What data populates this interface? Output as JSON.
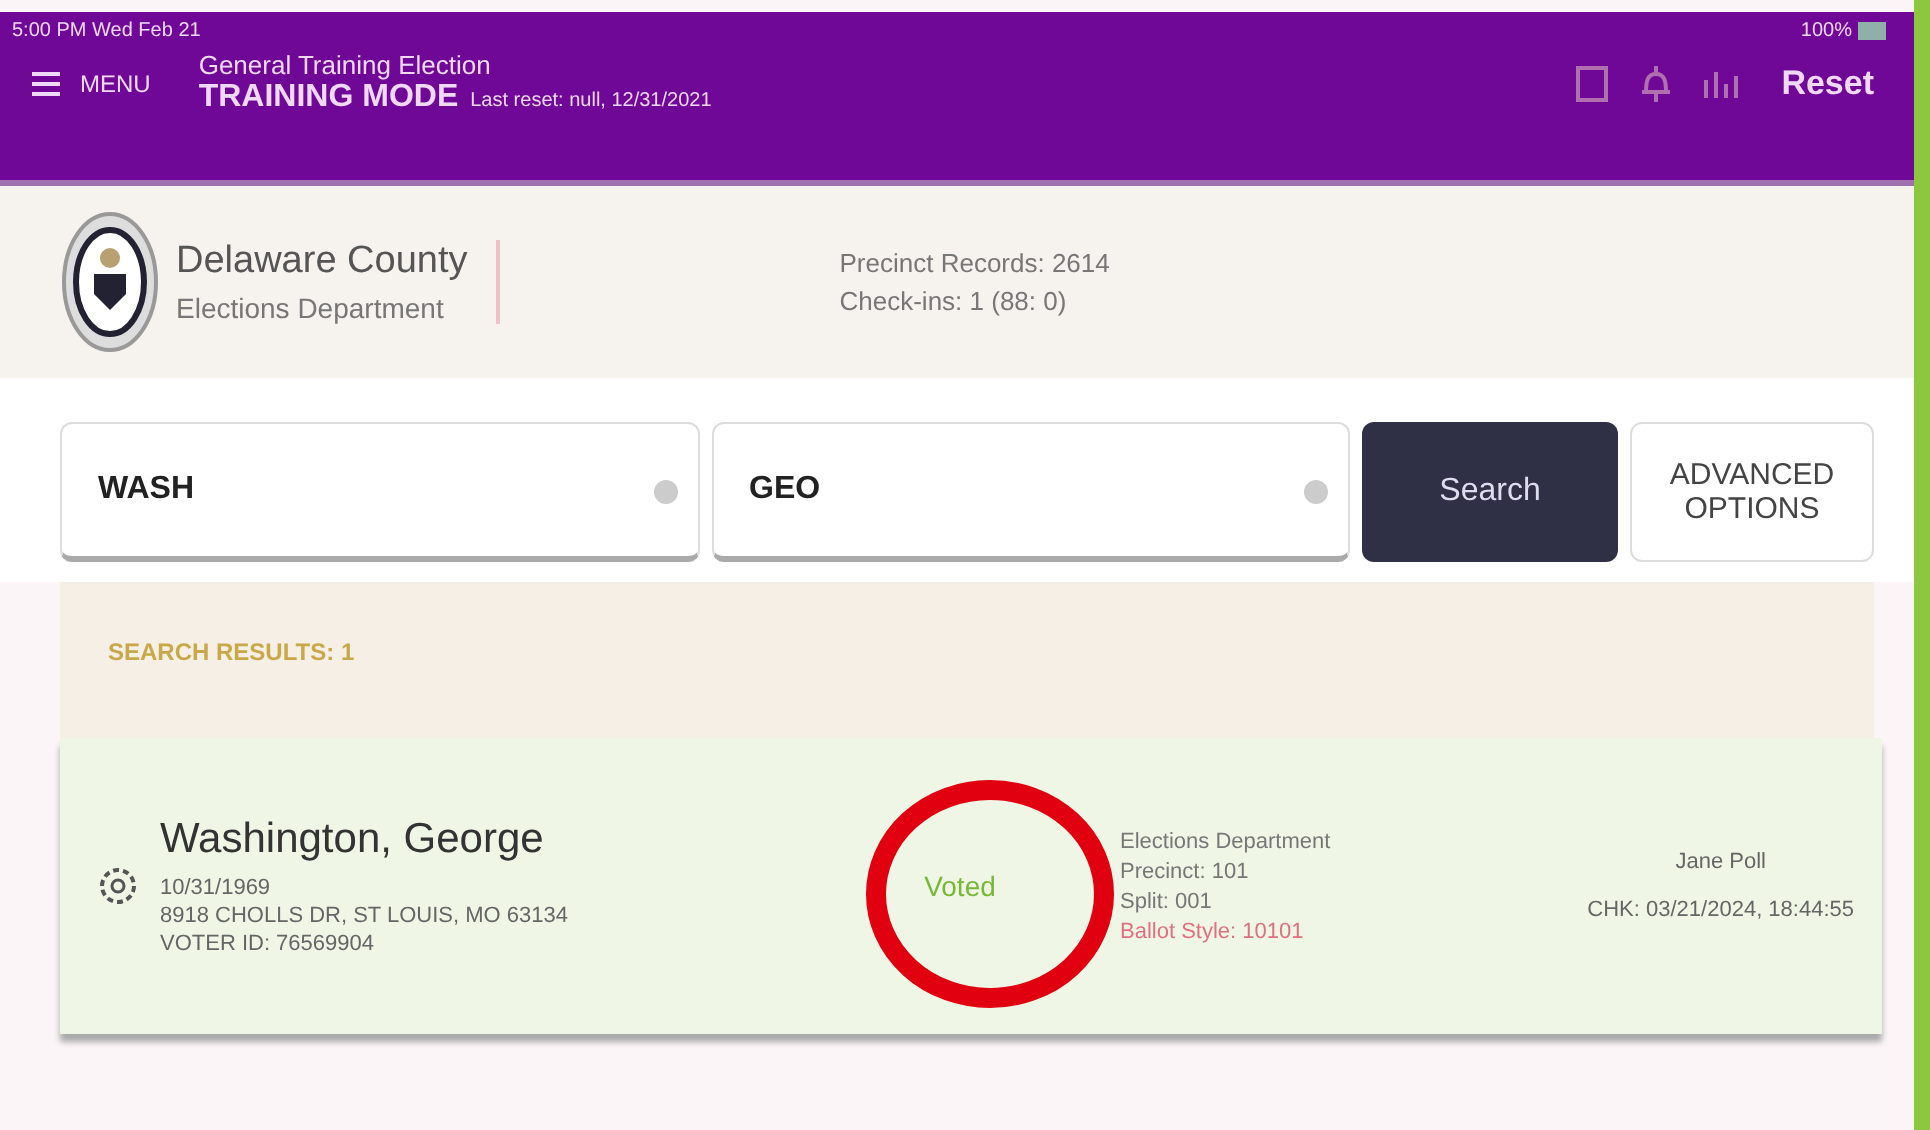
{
  "status_bar": {
    "time": "5:00 PM  Wed Feb 21",
    "battery": "100%"
  },
  "header": {
    "menu_label": "MENU",
    "election": "General Training Election",
    "mode": "TRAINING MODE",
    "mode_note": "Last reset: null, 12/31/2021",
    "reset_label": "Reset"
  },
  "organization": {
    "name": "Delaware County",
    "department": "Elections Department",
    "records": "Precinct Records: 2614",
    "checkins": "Check-ins: 1 (88: 0)"
  },
  "search": {
    "fields": [
      {
        "value": "WASH"
      },
      {
        "value": "GEO"
      }
    ],
    "search_button": "Search",
    "advanced_button": "ADVANCED OPTIONS"
  },
  "results": {
    "title": "SEARCH RESULTS: 1",
    "rows": [
      {
        "name": "Washington, George",
        "birth_date": "10/31/1969",
        "address": "8918 CHOLLS DR, ST LOUIS, MO 63134",
        "voter_id": "VOTER ID: 76569904",
        "status": "Voted",
        "location": "Elections Department",
        "precinct": "Precinct: 101",
        "split": "Split: 001",
        "ballot_style": "Ballot Style: 10101",
        "clerk": "Jane Poll",
        "checked_in": "CHK: 03/21/2024, 18:44:55",
        "highlighted": true
      }
    ]
  }
}
